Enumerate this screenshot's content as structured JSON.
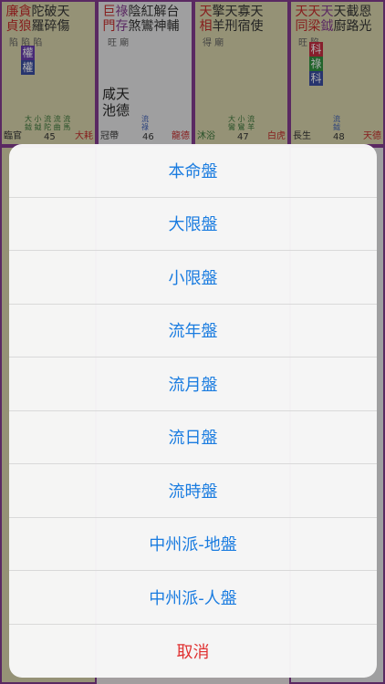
{
  "palaces": [
    {
      "stars_line1": [
        "廉",
        "貪",
        "陀",
        "破",
        "天"
      ],
      "stars_line2": [
        "貞",
        "狼",
        "羅",
        "碎",
        "傷"
      ],
      "status": "陷  陷  陷",
      "hua": [
        "權",
        "權"
      ],
      "minor_col": [
        "大",
        "小",
        "流",
        "流",
        "流"
      ],
      "minor_col2": [
        "鉞",
        "鉞",
        "陀",
        "曲",
        "馬"
      ],
      "age": "45",
      "left_label": "臨官",
      "right_label": "大耗"
    },
    {
      "stars_line1": [
        "巨",
        "祿",
        "陰",
        "紅",
        "解",
        "台"
      ],
      "stars_line2": [
        "門",
        "存",
        "煞",
        "鸞",
        "神",
        "輔"
      ],
      "status": "旺  廟",
      "mid1": "咸天",
      "mid2": "池德",
      "minor_col": [
        "流"
      ],
      "minor_col2": [
        "祿"
      ],
      "age": "46",
      "left_label": "冠帶",
      "right_label": "龍德"
    },
    {
      "stars_line1": [
        "天",
        "擎",
        "天",
        "寡",
        "天"
      ],
      "stars_line2": [
        "相",
        "羊",
        "刑",
        "宿",
        "使"
      ],
      "status": "得  廟",
      "minor_col": [
        "大",
        "小",
        "流"
      ],
      "minor_col2": [
        "鸞",
        "鸞",
        "羊"
      ],
      "age": "47",
      "left_label": "沐浴",
      "right_label": "白虎"
    },
    {
      "stars_line1": [
        "天",
        "天",
        "天",
        "天",
        "截",
        "恩"
      ],
      "stars_line2": [
        "同",
        "梁",
        "鉞",
        "廚",
        "路",
        "光"
      ],
      "status": "旺  陷",
      "hua": [
        "科",
        "祿",
        "科"
      ],
      "minor_col": [
        "流"
      ],
      "minor_col2": [
        "鉞"
      ],
      "age": "48",
      "left_label": "長生",
      "right_label": "天德"
    }
  ],
  "action_sheet": {
    "options": [
      "本命盤",
      "大限盤",
      "小限盤",
      "流年盤",
      "流月盤",
      "流日盤",
      "流時盤",
      "中州派-地盤",
      "中州派-人盤"
    ],
    "cancel": "取消"
  }
}
